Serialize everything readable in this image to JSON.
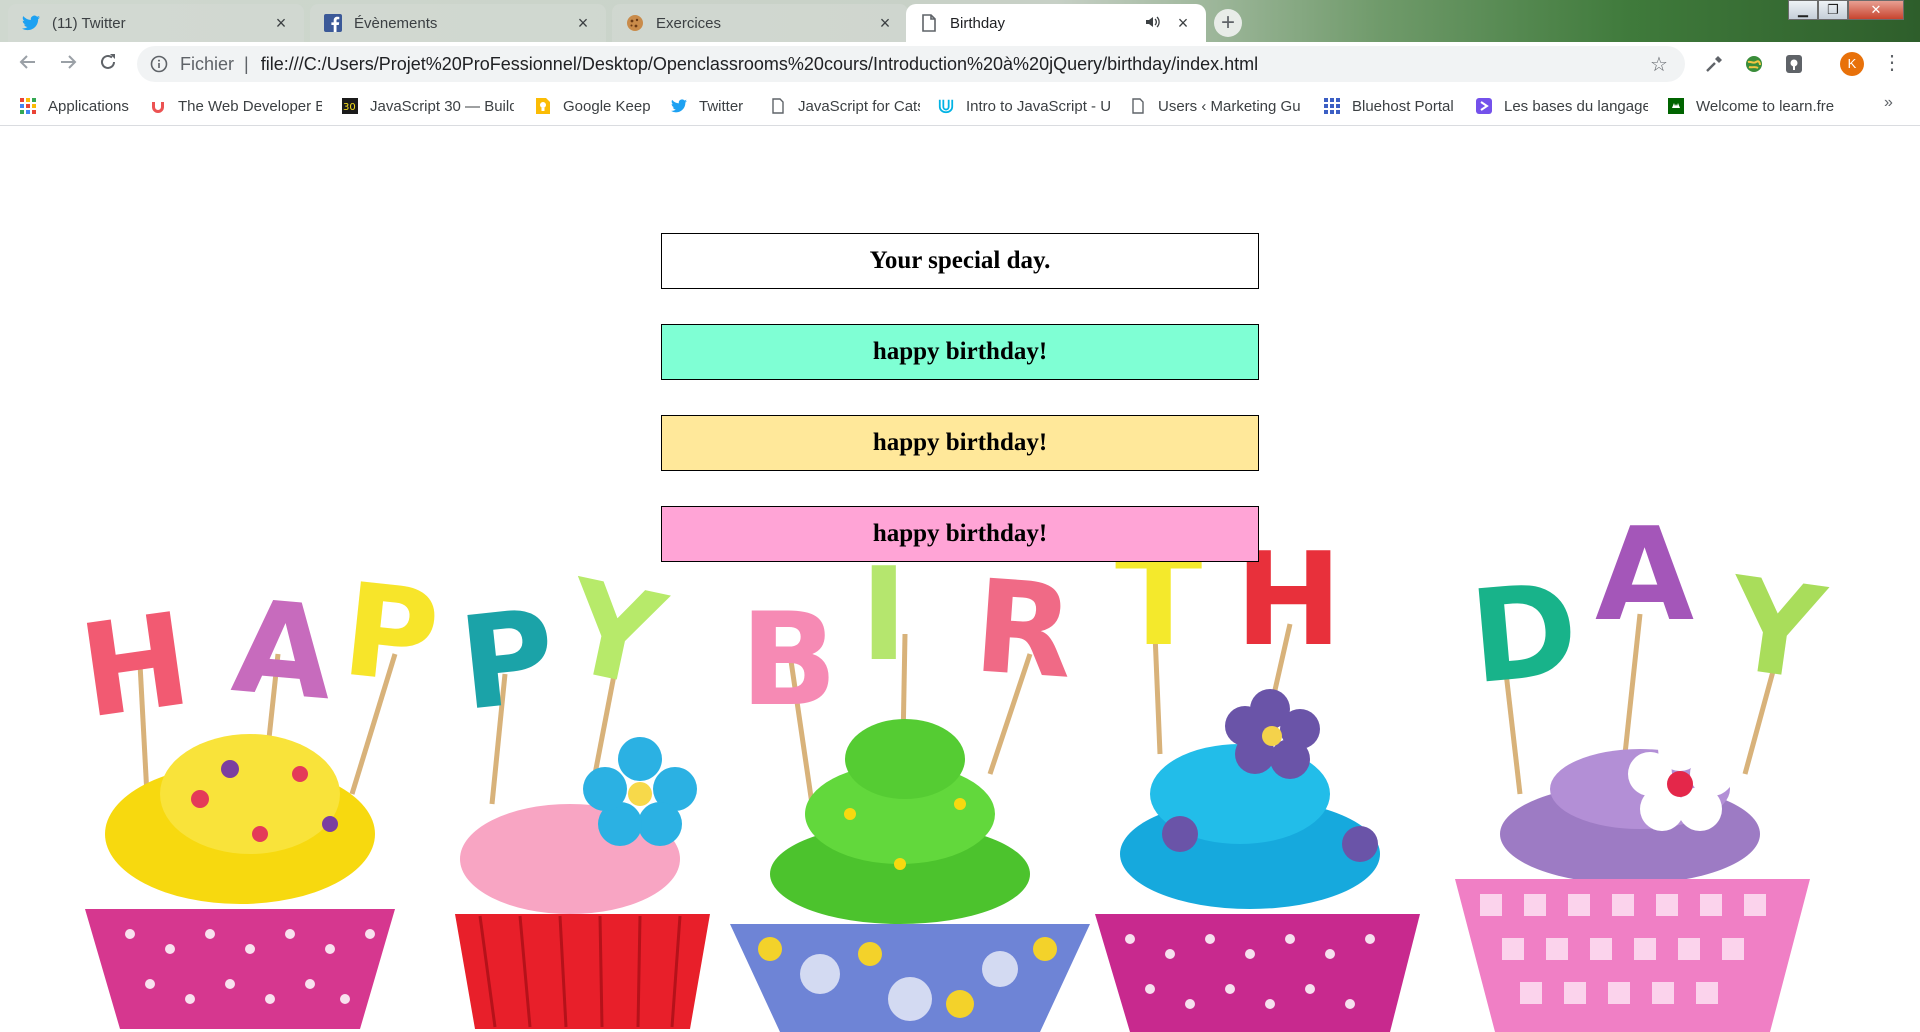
{
  "browser": {
    "tabs": [
      {
        "title": "(11) Twitter",
        "icon": "twitter-icon",
        "active": false
      },
      {
        "title": "Évènements",
        "icon": "facebook-icon",
        "active": false
      },
      {
        "title": "Exercices",
        "icon": "cookie-icon",
        "active": false
      },
      {
        "title": "Birthday",
        "icon": "page-icon",
        "active": true
      }
    ],
    "omnibox": {
      "scheme_label": "Fichier",
      "separator": "|",
      "url": "file:///C:/Users/Projet%20ProFessionnel/Desktop/Openclassrooms%20cours/Introduction%20à%20jQuery/birthday/index.html"
    },
    "profile_initial": "K",
    "bookmarks": [
      {
        "label": "Applications",
        "icon": "apps-grid-icon"
      },
      {
        "label": "The Web Developer B",
        "icon": "udemy-icon"
      },
      {
        "label": "JavaScript 30 — Build",
        "icon": "js30-icon"
      },
      {
        "label": "Google Keep",
        "icon": "keep-icon"
      },
      {
        "label": "Twitter",
        "icon": "twitter-icon"
      },
      {
        "label": "JavaScript for Cats",
        "icon": "page-icon"
      },
      {
        "label": "Intro to JavaScript - U",
        "icon": "udacity-icon"
      },
      {
        "label": "Users ‹ Marketing Gu",
        "icon": "page-icon"
      },
      {
        "label": "Bluehost Portal",
        "icon": "bluehost-grid-icon"
      },
      {
        "label": "Les bases du langage",
        "icon": "openclassrooms-icon"
      },
      {
        "label": "Welcome to learn.fre",
        "icon": "freecodecamp-icon"
      }
    ],
    "bookmarks_overflow": "»"
  },
  "page": {
    "boxes": [
      {
        "text": "Your special day.",
        "bg": "#ffffff"
      },
      {
        "text": "happy birthday!",
        "bg": "#7fffd4"
      },
      {
        "text": "happy birthday!",
        "bg": "#ffe89a"
      },
      {
        "text": "happy birthday!",
        "bg": "#ffa4d6"
      }
    ],
    "banner_letters": "HAPPY BIRTHDAY"
  },
  "colors": {
    "accent_orange": "#e8710a",
    "twitter_blue": "#1da1f2",
    "facebook_blue": "#3b5998"
  }
}
